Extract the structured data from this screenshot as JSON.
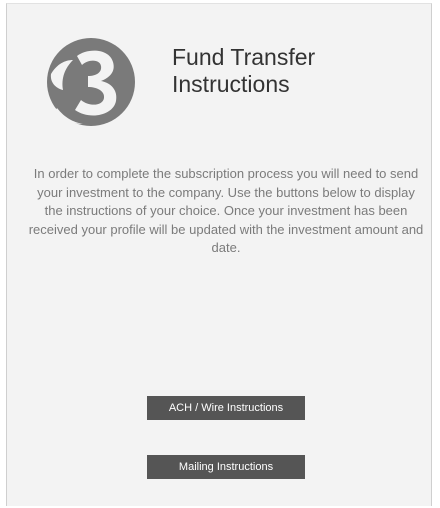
{
  "header": {
    "step_icon": "step-3-circle-icon",
    "title_line1": "Fund Transfer",
    "title_line2": "Instructions"
  },
  "intro": {
    "text": "In order to complete the subscription process you will need to send your investment to the company. Use the buttons below to display the instructions of your choice. Once your investment has been received your profile will be updated with the investment amount and date."
  },
  "buttons": {
    "ach_label": "ACH / Wire Instructions",
    "mailing_label": "Mailing Instructions"
  },
  "colors": {
    "icon": "#7a7a7a",
    "button_bg": "#555555",
    "panel_bg": "#f3f3f3"
  }
}
